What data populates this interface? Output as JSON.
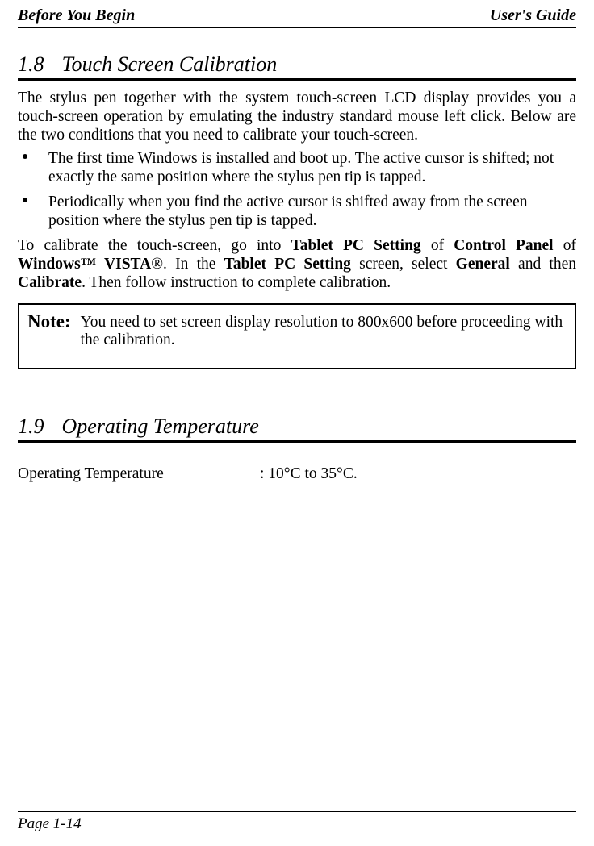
{
  "header": {
    "left": "Before You Begin",
    "right": "User's Guide"
  },
  "section1": {
    "number": "1.8",
    "title": "Touch Screen Calibration",
    "intro": "The stylus pen together with the system touch-screen LCD display provides you a touch-screen operation by emulating the industry standard mouse left click. Below are the two conditions that you need to calibrate your touch-screen.",
    "bullets": [
      "The first time Windows is installed and boot up. The active cursor is shifted; not exactly the same position where the stylus pen tip is tapped.",
      "Periodically when you find the active cursor is shifted away from the screen position where the stylus pen tip is tapped."
    ],
    "calib": {
      "p1": "To calibrate the touch-screen, go into ",
      "p2": "Tablet PC Setting",
      "p3": " of ",
      "p4": "Control Panel",
      "p5": " of ",
      "p6": "Windows™ VISTA",
      "p7": "®. In the ",
      "p8": "Tablet PC Setting",
      "p9": " screen, select ",
      "p10": "General",
      "p11": " and then ",
      "p12": "Calibrate",
      "p13": ". Then follow instruction to complete calibration."
    },
    "note": {
      "label": "Note:",
      "text": "You need to set screen display resolution to 800x600 before proceeding with the calibration."
    }
  },
  "section2": {
    "number": "1.9",
    "title": "Operating Temperature",
    "spec_label": "Operating Temperature",
    "spec_value": ": 10°C to 35°C."
  },
  "footer": {
    "page": "Page 1-14"
  }
}
